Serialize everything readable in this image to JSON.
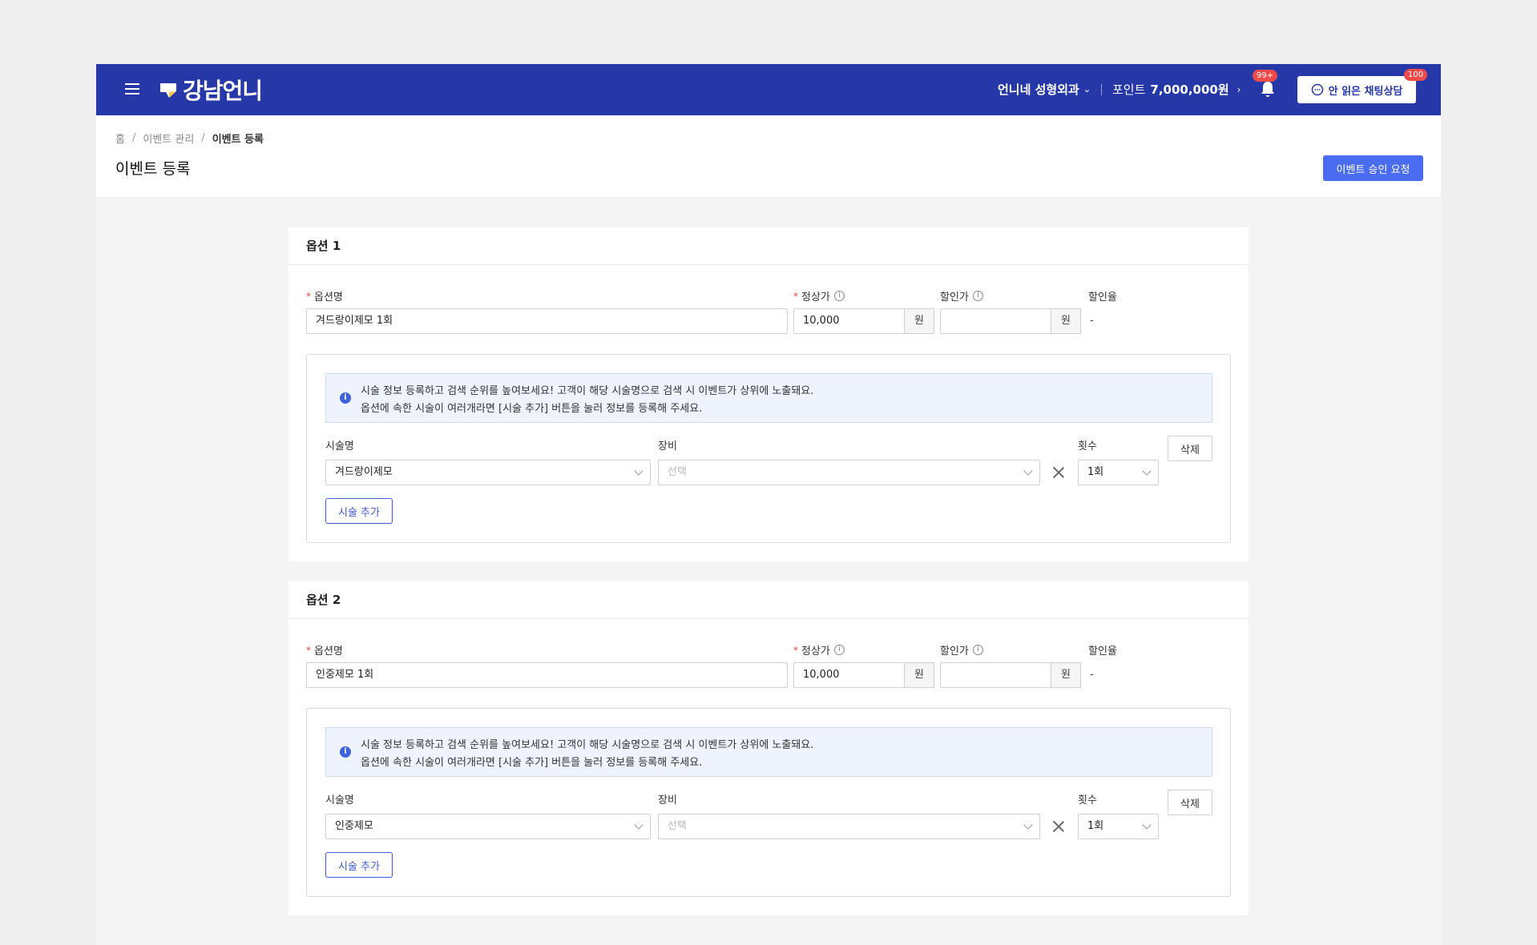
{
  "header": {
    "logo_text": "강남언니",
    "hospital_name": "언니네 성형외과",
    "points_label": "포인트",
    "points_value": "7,000,000원",
    "notification_badge": "99+",
    "chat_button_label": "안 읽은 채팅상담",
    "chat_badge": "100",
    "brand_color": "#2638a8"
  },
  "breadcrumb": [
    "홈",
    "이벤트 관리",
    "이벤트 등록"
  ],
  "page": {
    "title": "이벤트 등록",
    "approve_button": "이벤트 승인 요청"
  },
  "labels": {
    "option_name": "옵션명",
    "regular_price": "정상가",
    "discount_price": "할인가",
    "discount_rate": "할인율",
    "currency_suffix": "원",
    "procedure_name": "시술명",
    "equipment": "장비",
    "count": "횟수",
    "delete_button": "삭제",
    "add_procedure_button": "시술 추가",
    "notice_line1": "시술 정보 등록하고 검색 순위를 높여보세요! 고객이 해당 시술명으로 검색 시 이벤트가 상위에 노출돼요.",
    "notice_line2": "옵션에 속한 시술이 여러개라면 [시술 추가] 버튼을 눌러 정보를 등록해 주세요."
  },
  "options": [
    {
      "title": "옵션 1",
      "option_name_value": "겨드랑이제모 1회",
      "regular_price_value": "10,000",
      "discount_price_value": "",
      "discount_rate_value": "-",
      "procedure_value": "겨드랑이제모",
      "equipment_placeholder": "선택",
      "count_value": "1회"
    },
    {
      "title": "옵션 2",
      "option_name_value": "인중제모 1회",
      "regular_price_value": "10,000",
      "discount_price_value": "",
      "discount_rate_value": "-",
      "procedure_value": "인중제모",
      "equipment_placeholder": "선택",
      "count_value": "1회"
    }
  ]
}
